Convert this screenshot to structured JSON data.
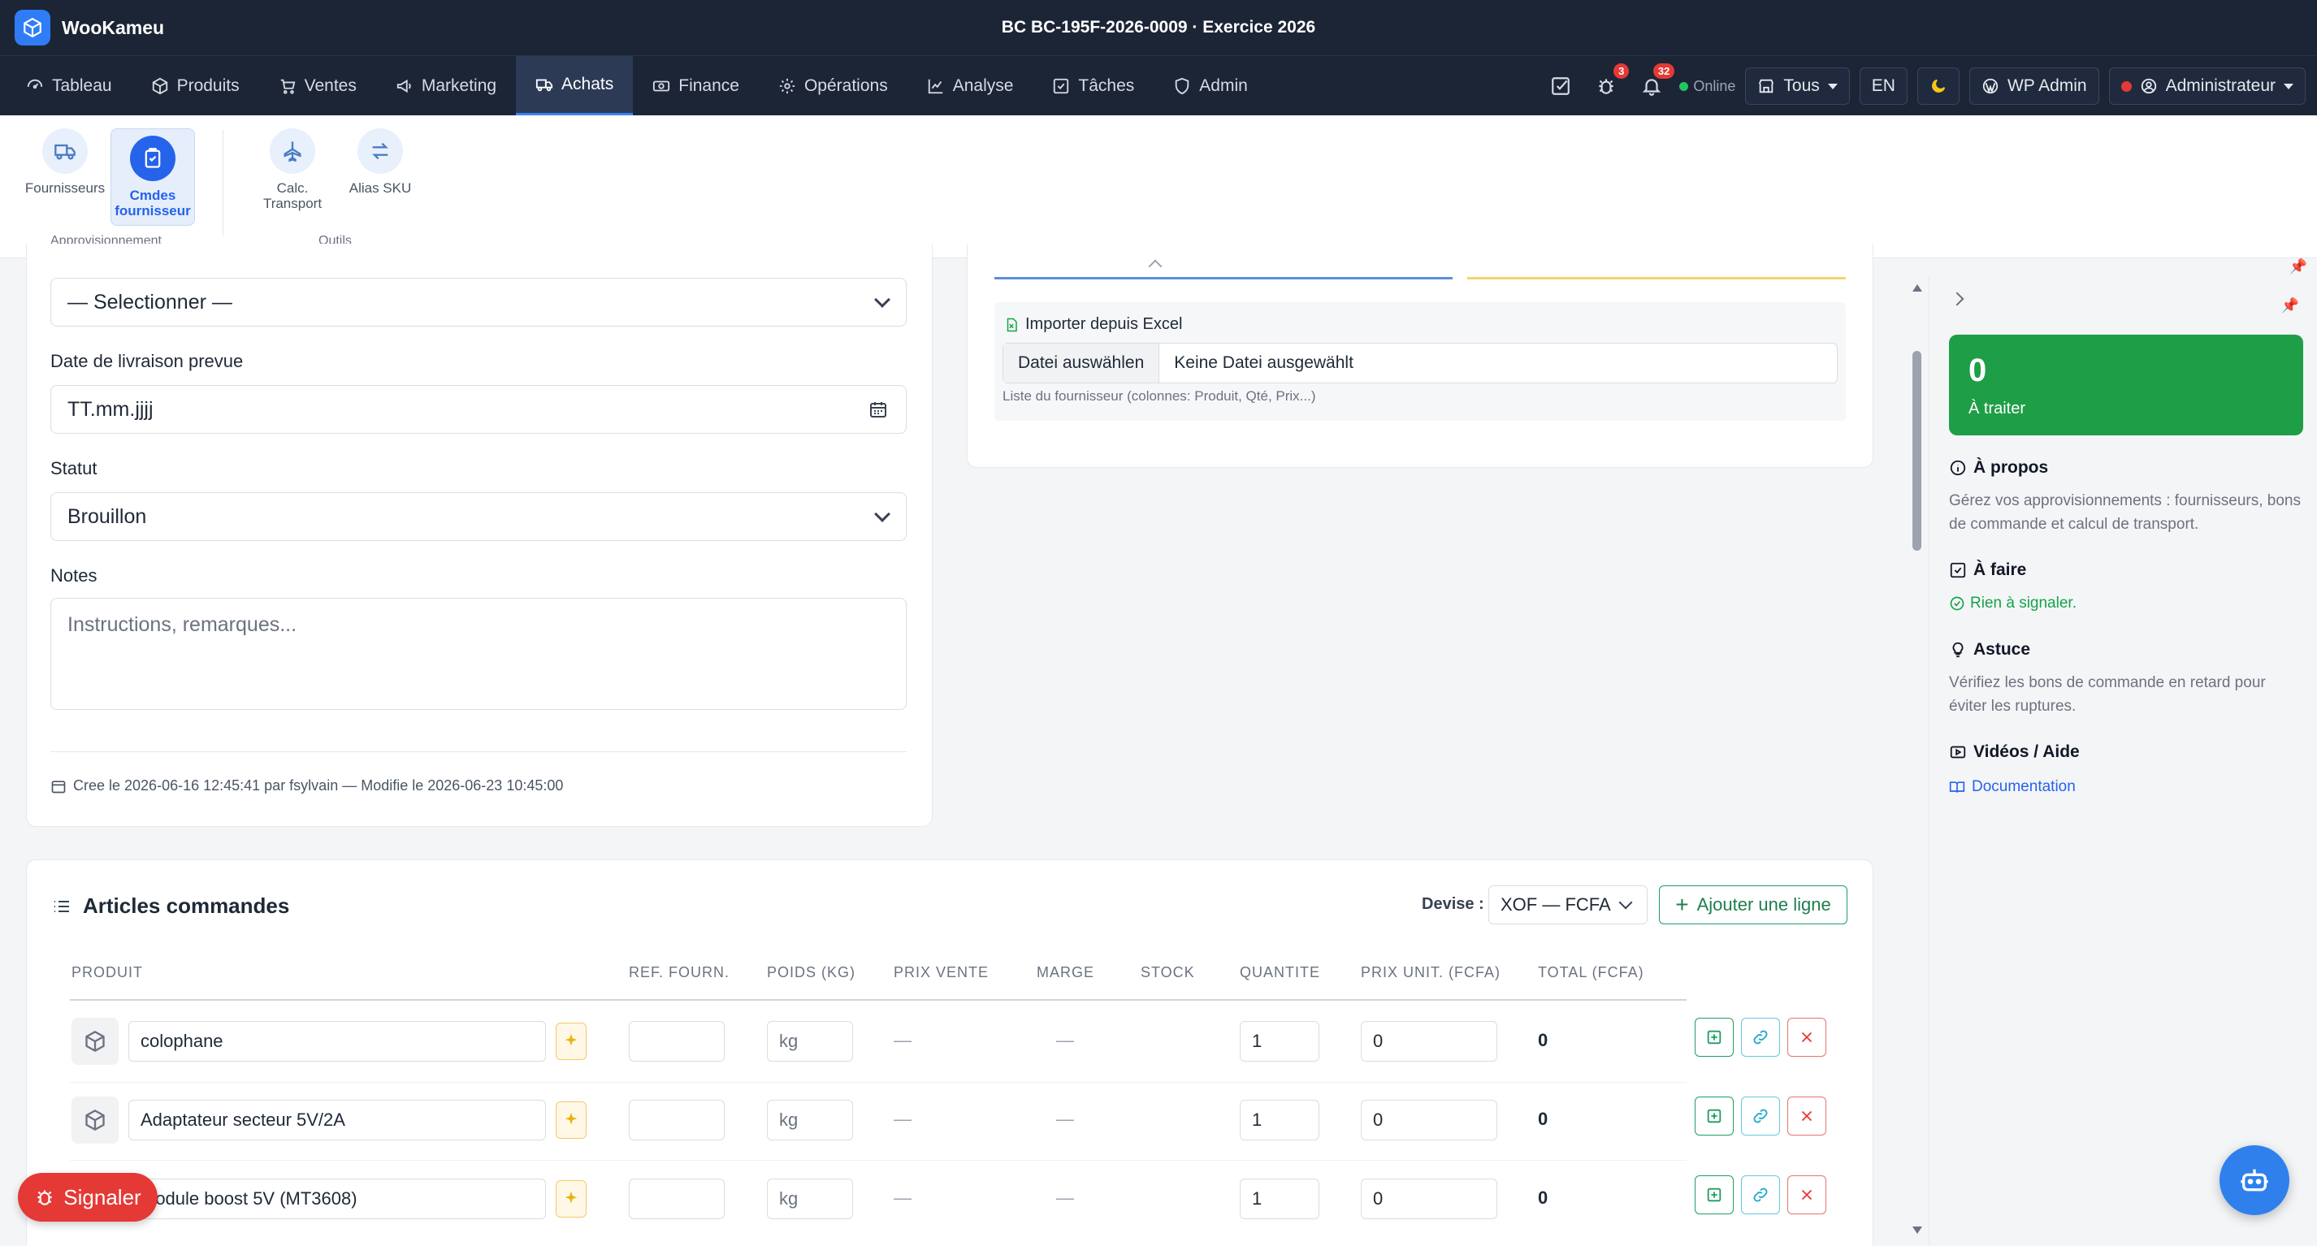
{
  "app": {
    "name": "WooKameu",
    "doc_title": "BC BC-195F-2026-0009 · Exercice 2026"
  },
  "nav": {
    "items": [
      {
        "label": "Tableau",
        "icon": "dashboard-icon"
      },
      {
        "label": "Produits",
        "icon": "box-icon"
      },
      {
        "label": "Ventes",
        "icon": "cart-icon"
      },
      {
        "label": "Marketing",
        "icon": "megaphone-icon"
      },
      {
        "label": "Achats",
        "icon": "truck-icon",
        "active": true
      },
      {
        "label": "Finance",
        "icon": "money-icon"
      },
      {
        "label": "Opérations",
        "icon": "gear-icon"
      },
      {
        "label": "Analyse",
        "icon": "chart-icon"
      },
      {
        "label": "Tâches",
        "icon": "checkbox-icon"
      },
      {
        "label": "Admin",
        "icon": "shield-icon"
      }
    ],
    "bug_badge": "3",
    "notif_badge": "32",
    "online": "Online",
    "store_select": "Tous",
    "lang": "EN",
    "wp_admin": "WP Admin",
    "user": "Administrateur"
  },
  "ribbon": {
    "items": [
      {
        "label": "Fournisseurs"
      },
      {
        "label": "Cmdes fournisseur",
        "active": true
      },
      {
        "label": "Calc. Transport"
      },
      {
        "label": "Alias SKU"
      }
    ],
    "group_approvisionnement": "Approvisionnement",
    "group_outils": "Outils"
  },
  "form": {
    "supplier_select": "— Selectionner —",
    "delivery_label": "Date de livraison prevue",
    "delivery_placeholder": "TT.mm.jjjj",
    "status_label": "Statut",
    "status_value": "Brouillon",
    "notes_label": "Notes",
    "notes_placeholder": "Instructions, remarques...",
    "meta": "Cree le 2026-06-16 12:45:41 par fsylvain — Modifie le 2026-06-23 10:45:00"
  },
  "import": {
    "title": "Importer depuis Excel",
    "file_button": "Datei auswählen",
    "file_status": "Keine Datei ausgewählt",
    "hint": "Liste du fournisseur (colonnes: Produit, Qté, Prix...)"
  },
  "sidebar": {
    "count": "0",
    "count_label": "À traiter",
    "about_title": "À propos",
    "about_text": "Gérez vos approvisionnements : fournisseurs, bons de commande et calcul de transport.",
    "todo_title": "À faire",
    "todo_text": "Rien à signaler.",
    "tip_title": "Astuce",
    "tip_text": "Vérifiez les bons de commande en retard pour éviter les ruptures.",
    "videos_title": "Vidéos / Aide",
    "doc_link": "Documentation"
  },
  "articles": {
    "title": "Articles commandes",
    "currency_label": "Devise :",
    "currency_value": "XOF — FCFA",
    "add_line": "Ajouter une ligne",
    "columns": [
      "PRODUIT",
      "REF. FOURN.",
      "POIDS (KG)",
      "PRIX VENTE",
      "MARGE",
      "STOCK",
      "QUANTITE",
      "PRIX UNIT. (FCFA)",
      "TOTAL (FCFA)"
    ],
    "rows": [
      {
        "product": "colophane",
        "weight_placeholder": "kg",
        "sale_price": "—",
        "margin": "—",
        "qty": "1",
        "unit_price": "0",
        "total": "0"
      },
      {
        "product": "Adaptateur secteur 5V/2A",
        "weight_placeholder": "kg",
        "sale_price": "—",
        "margin": "—",
        "qty": "1",
        "unit_price": "0",
        "total": "0"
      },
      {
        "product": "Module boost 5V (MT3608)",
        "weight_placeholder": "kg",
        "sale_price": "—",
        "margin": "—",
        "qty": "1",
        "unit_price": "0",
        "total": "0"
      }
    ]
  },
  "report_button": "Signaler",
  "colors": {
    "accent": "#2563eb",
    "nav_bg": "#1c2536",
    "success": "#1e9e47",
    "danger": "#e53935"
  }
}
